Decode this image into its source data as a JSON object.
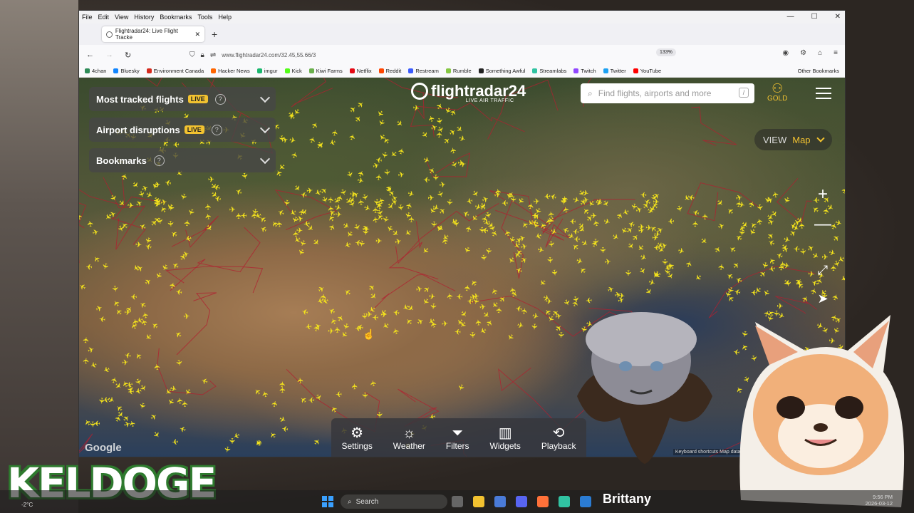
{
  "browser": {
    "menu": [
      "File",
      "Edit",
      "View",
      "History",
      "Bookmarks",
      "Tools",
      "Help"
    ],
    "tab_title": "Flightradar24: Live Flight Tracke",
    "url": "www.flightradar24.com/32.45,55.66/3",
    "zoom": "133%",
    "bookmarks": [
      {
        "label": "4chan",
        "color": "#2e8b57"
      },
      {
        "label": "Bluesky",
        "color": "#1185fe"
      },
      {
        "label": "Environment Canada",
        "color": "#d52b1e"
      },
      {
        "label": "Hacker News",
        "color": "#ff6600"
      },
      {
        "label": "imgur",
        "color": "#1bb76e"
      },
      {
        "label": "Kick",
        "color": "#53fc18"
      },
      {
        "label": "Kiwi Farms",
        "color": "#6ab04c"
      },
      {
        "label": "Netflix",
        "color": "#e50914"
      },
      {
        "label": "Reddit",
        "color": "#ff4500"
      },
      {
        "label": "Restream",
        "color": "#3b5bfd"
      },
      {
        "label": "Rumble",
        "color": "#85c742"
      },
      {
        "label": "Something Awful",
        "color": "#222222"
      },
      {
        "label": "Streamlabs",
        "color": "#31c3a2"
      },
      {
        "label": "Twitch",
        "color": "#9146ff"
      },
      {
        "label": "Twitter",
        "color": "#1da1f2"
      },
      {
        "label": "YouTube",
        "color": "#ff0000"
      }
    ],
    "other_bookmarks": "Other Bookmarks"
  },
  "site": {
    "panels": [
      {
        "label": "Most tracked flights",
        "badge": "LIVE"
      },
      {
        "label": "Airport disruptions",
        "badge": "LIVE"
      },
      {
        "label": "Bookmarks",
        "badge": ""
      }
    ],
    "logo": "flightradar24",
    "logo_tagline": "LIVE AIR TRAFFIC",
    "search_placeholder": "Find flights, airports and more",
    "search_shortcut": "/",
    "gold_label": "GOLD",
    "view_label": "VIEW",
    "view_value": "Map",
    "toolbar": [
      {
        "label": "Settings",
        "icon": "gear-icon"
      },
      {
        "label": "Weather",
        "icon": "weather-icon"
      },
      {
        "label": "Filters",
        "icon": "filter-icon"
      },
      {
        "label": "Widgets",
        "icon": "widgets-icon"
      },
      {
        "label": "Playback",
        "icon": "playback-icon"
      }
    ],
    "map_brand": "Google",
    "attribution": "Keyboard shortcuts  Map data ©2026 NASA",
    "accent": "#f2c230",
    "plane_color": "#f5e41c"
  },
  "overlay": {
    "streamer": "KELDOGE",
    "name_tag": "Brittany",
    "taskbar_search": "Search",
    "temperature": "-2°C",
    "time": "9:56 PM",
    "date": "2026-03-12"
  }
}
